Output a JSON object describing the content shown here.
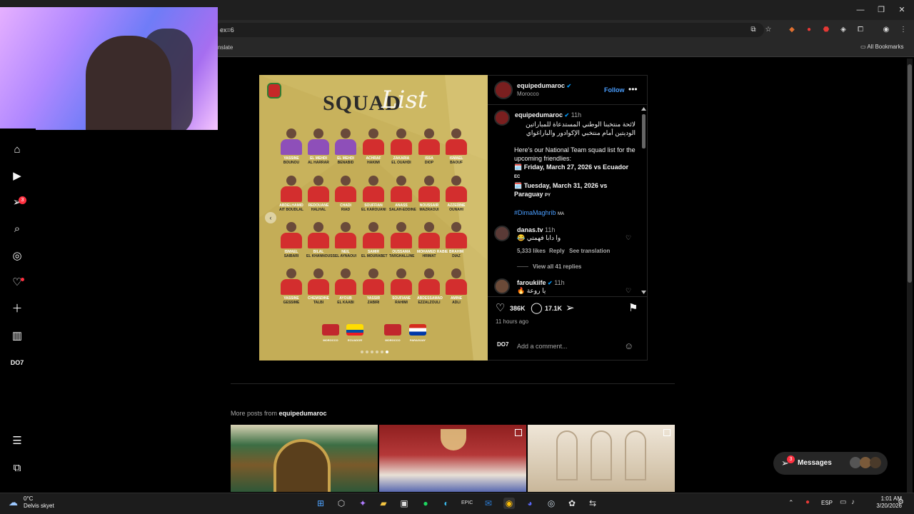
{
  "browser": {
    "url_fragment": "ex=6",
    "translate_label": "nslate",
    "all_bookmarks": "All Bookmarks"
  },
  "sidebar": {
    "notif_badge": "3"
  },
  "post_image": {
    "title_word": "SQUAD",
    "title_script": "List",
    "players": [
      [
        {
          "first": "YASSINE",
          "last": "BOUNOU",
          "gk": true
        },
        {
          "first": "EL MEHDI",
          "last": "AL HARRAR",
          "gk": true
        },
        {
          "first": "EL MEHDI",
          "last": "BENABID",
          "gk": true
        },
        {
          "first": "ACHRAF",
          "last": "HAKIMI"
        },
        {
          "first": "ZAKARIA",
          "last": "EL OUAHDI"
        },
        {
          "first": "ISSA",
          "last": "DIOP"
        },
        {
          "first": "ISMAEL",
          "last": "BAOUF"
        }
      ],
      [
        {
          "first": "ABDELHAMID",
          "last": "AIT BOUDLAL"
        },
        {
          "first": "REDOUANE",
          "last": "HALHAL"
        },
        {
          "first": "CHADI",
          "last": "RIAD"
        },
        {
          "first": "SOUFFIAN",
          "last": "EL KAROUANI"
        },
        {
          "first": "ANASS",
          "last": "SALAH-EDDINE"
        },
        {
          "first": "NOUSSAIR",
          "last": "MAZRAOUI"
        },
        {
          "first": "AZZEDINE",
          "last": "OUNAHI"
        }
      ],
      [
        {
          "first": "ISMAEL",
          "last": "SAIBARI"
        },
        {
          "first": "BILAL",
          "last": "EL KHANNOUSS"
        },
        {
          "first": "NEIL",
          "last": "EL AYNAOUI"
        },
        {
          "first": "SAMIR",
          "last": "EL MOURABET"
        },
        {
          "first": "OUSSAMA",
          "last": "TARGHALLINE"
        },
        {
          "first": "MOHAMED RABIE",
          "last": "HRIMAT"
        },
        {
          "first": "BRAHIM",
          "last": "DIAZ"
        }
      ],
      [
        {
          "first": "YASSINE",
          "last": "GESSIME"
        },
        {
          "first": "CHEMSDINE",
          "last": "TALBI"
        },
        {
          "first": "AYOUB",
          "last": "EL KAABI"
        },
        {
          "first": "YASSIR",
          "last": "ZABIRI"
        },
        {
          "first": "SOUFIANE",
          "last": "RAHIMI"
        },
        {
          "first": "ABDESSAMAD",
          "last": "EZZALZOULI"
        },
        {
          "first": "AMINE",
          "last": "ADLI"
        }
      ]
    ],
    "fixture_labels": [
      "MOROCCO",
      "ECUADOR",
      "MOROCCO",
      "PARAGUAY"
    ]
  },
  "post": {
    "account": "equipedumaroc",
    "location": "Morocco",
    "follow_label": "Follow",
    "more_label": "•••",
    "caption_time": "11h",
    "caption_arabic": "لائحة منتخبنا الوطني المستدعاة للمباراتين الوديتين أمام منتخبي الإكوادور والباراغواي",
    "caption_en_1": "Here's our National Team squad list for the upcoming friendlies:",
    "caption_fixture_1": "🗓️ Friday, March 27, 2026 vs Ecuador",
    "caption_fixture_1_flag": "EC",
    "caption_fixture_2": "🗓️ Tuesday, March 31, 2026 vs Paraguay",
    "caption_fixture_2_flag": "PY",
    "hashtag": "#DimaMaghrib",
    "hashtag_flag": "MA",
    "comments": [
      {
        "user": "danas.tv",
        "time": "11h",
        "text": "وا دابا فهمتي 😂",
        "likes": "5,333 likes",
        "reply": "Reply",
        "translate": "See translation",
        "view_replies": "View all 41 replies"
      },
      {
        "user": "faroukiife",
        "time": "11h",
        "text": "يا روعة 🔥"
      }
    ],
    "like_count": "386K",
    "comment_count": "17.1K",
    "posted_ago": "11 hours ago",
    "add_comment_placeholder": "Add a comment...",
    "user_badge": "DO7"
  },
  "more_posts": {
    "prefix": "More posts from",
    "account": "equipedumaroc"
  },
  "messages": {
    "label": "Messages",
    "badge": "3"
  },
  "taskbar": {
    "weather_temp": "0°C",
    "weather_desc": "Delvis skyet",
    "lang": "ESP",
    "time": "1:01 AM",
    "date": "3/20/2026"
  }
}
